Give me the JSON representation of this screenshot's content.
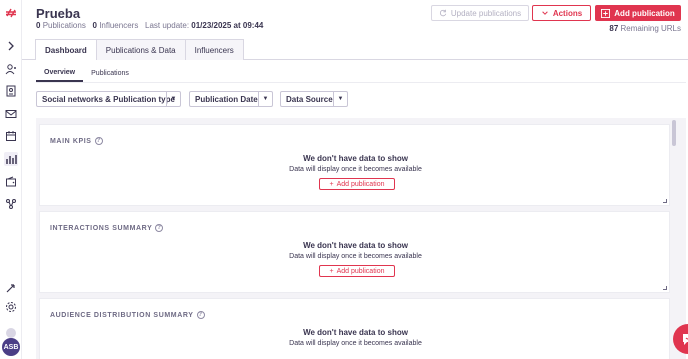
{
  "page": {
    "title": "Prueba",
    "publications_count": "0",
    "publications_label": "Publications",
    "influencers_count": "0",
    "influencers_label": "Influencers",
    "last_update_label": "Last update:",
    "last_update_value": "01/23/2025 at 09:44"
  },
  "header_actions": {
    "update_label": "Update publications",
    "actions_label": "Actions",
    "add_label": "Add publication",
    "remaining_count": "87",
    "remaining_label": "Remaining URLs"
  },
  "tabs": [
    {
      "label": "Dashboard",
      "active": true
    },
    {
      "label": "Publications & Data",
      "active": false
    },
    {
      "label": "Influencers",
      "active": false
    }
  ],
  "subtabs": [
    {
      "label": "Overview",
      "active": true
    },
    {
      "label": "Publications",
      "active": false
    }
  ],
  "filters": [
    {
      "label": "Social networks & Publication type"
    },
    {
      "label": "Publication Date"
    },
    {
      "label": "Data Source"
    }
  ],
  "cards": [
    {
      "title": "MAIN KPIS",
      "empty_title": "We don't have data to show",
      "empty_sub": "Data will display once it becomes available",
      "button": "Add publication"
    },
    {
      "title": "INTERACTIONS SUMMARY",
      "empty_title": "We don't have data to show",
      "empty_sub": "Data will display once it becomes available",
      "button": "Add publication"
    },
    {
      "title": "AUDIENCE DISTRIBUTION SUMMARY",
      "empty_title": "We don't have data to show",
      "empty_sub": "Data will display once it becomes available"
    }
  ],
  "user": {
    "initials": "ASB"
  },
  "colors": {
    "accent": "#e0354f",
    "text": "#3a3550",
    "avatar": "#4b3e86"
  },
  "icons": [
    "logo-icon",
    "expand-icon",
    "users-icon",
    "contacts-icon",
    "mail-icon",
    "calendar-icon",
    "analytics-icon",
    "wallet-icon",
    "workflow-icon",
    "rocket-icon",
    "settings-icon",
    "refresh-icon",
    "chevron-down-icon",
    "plus-icon",
    "help-icon",
    "chat-icon"
  ]
}
